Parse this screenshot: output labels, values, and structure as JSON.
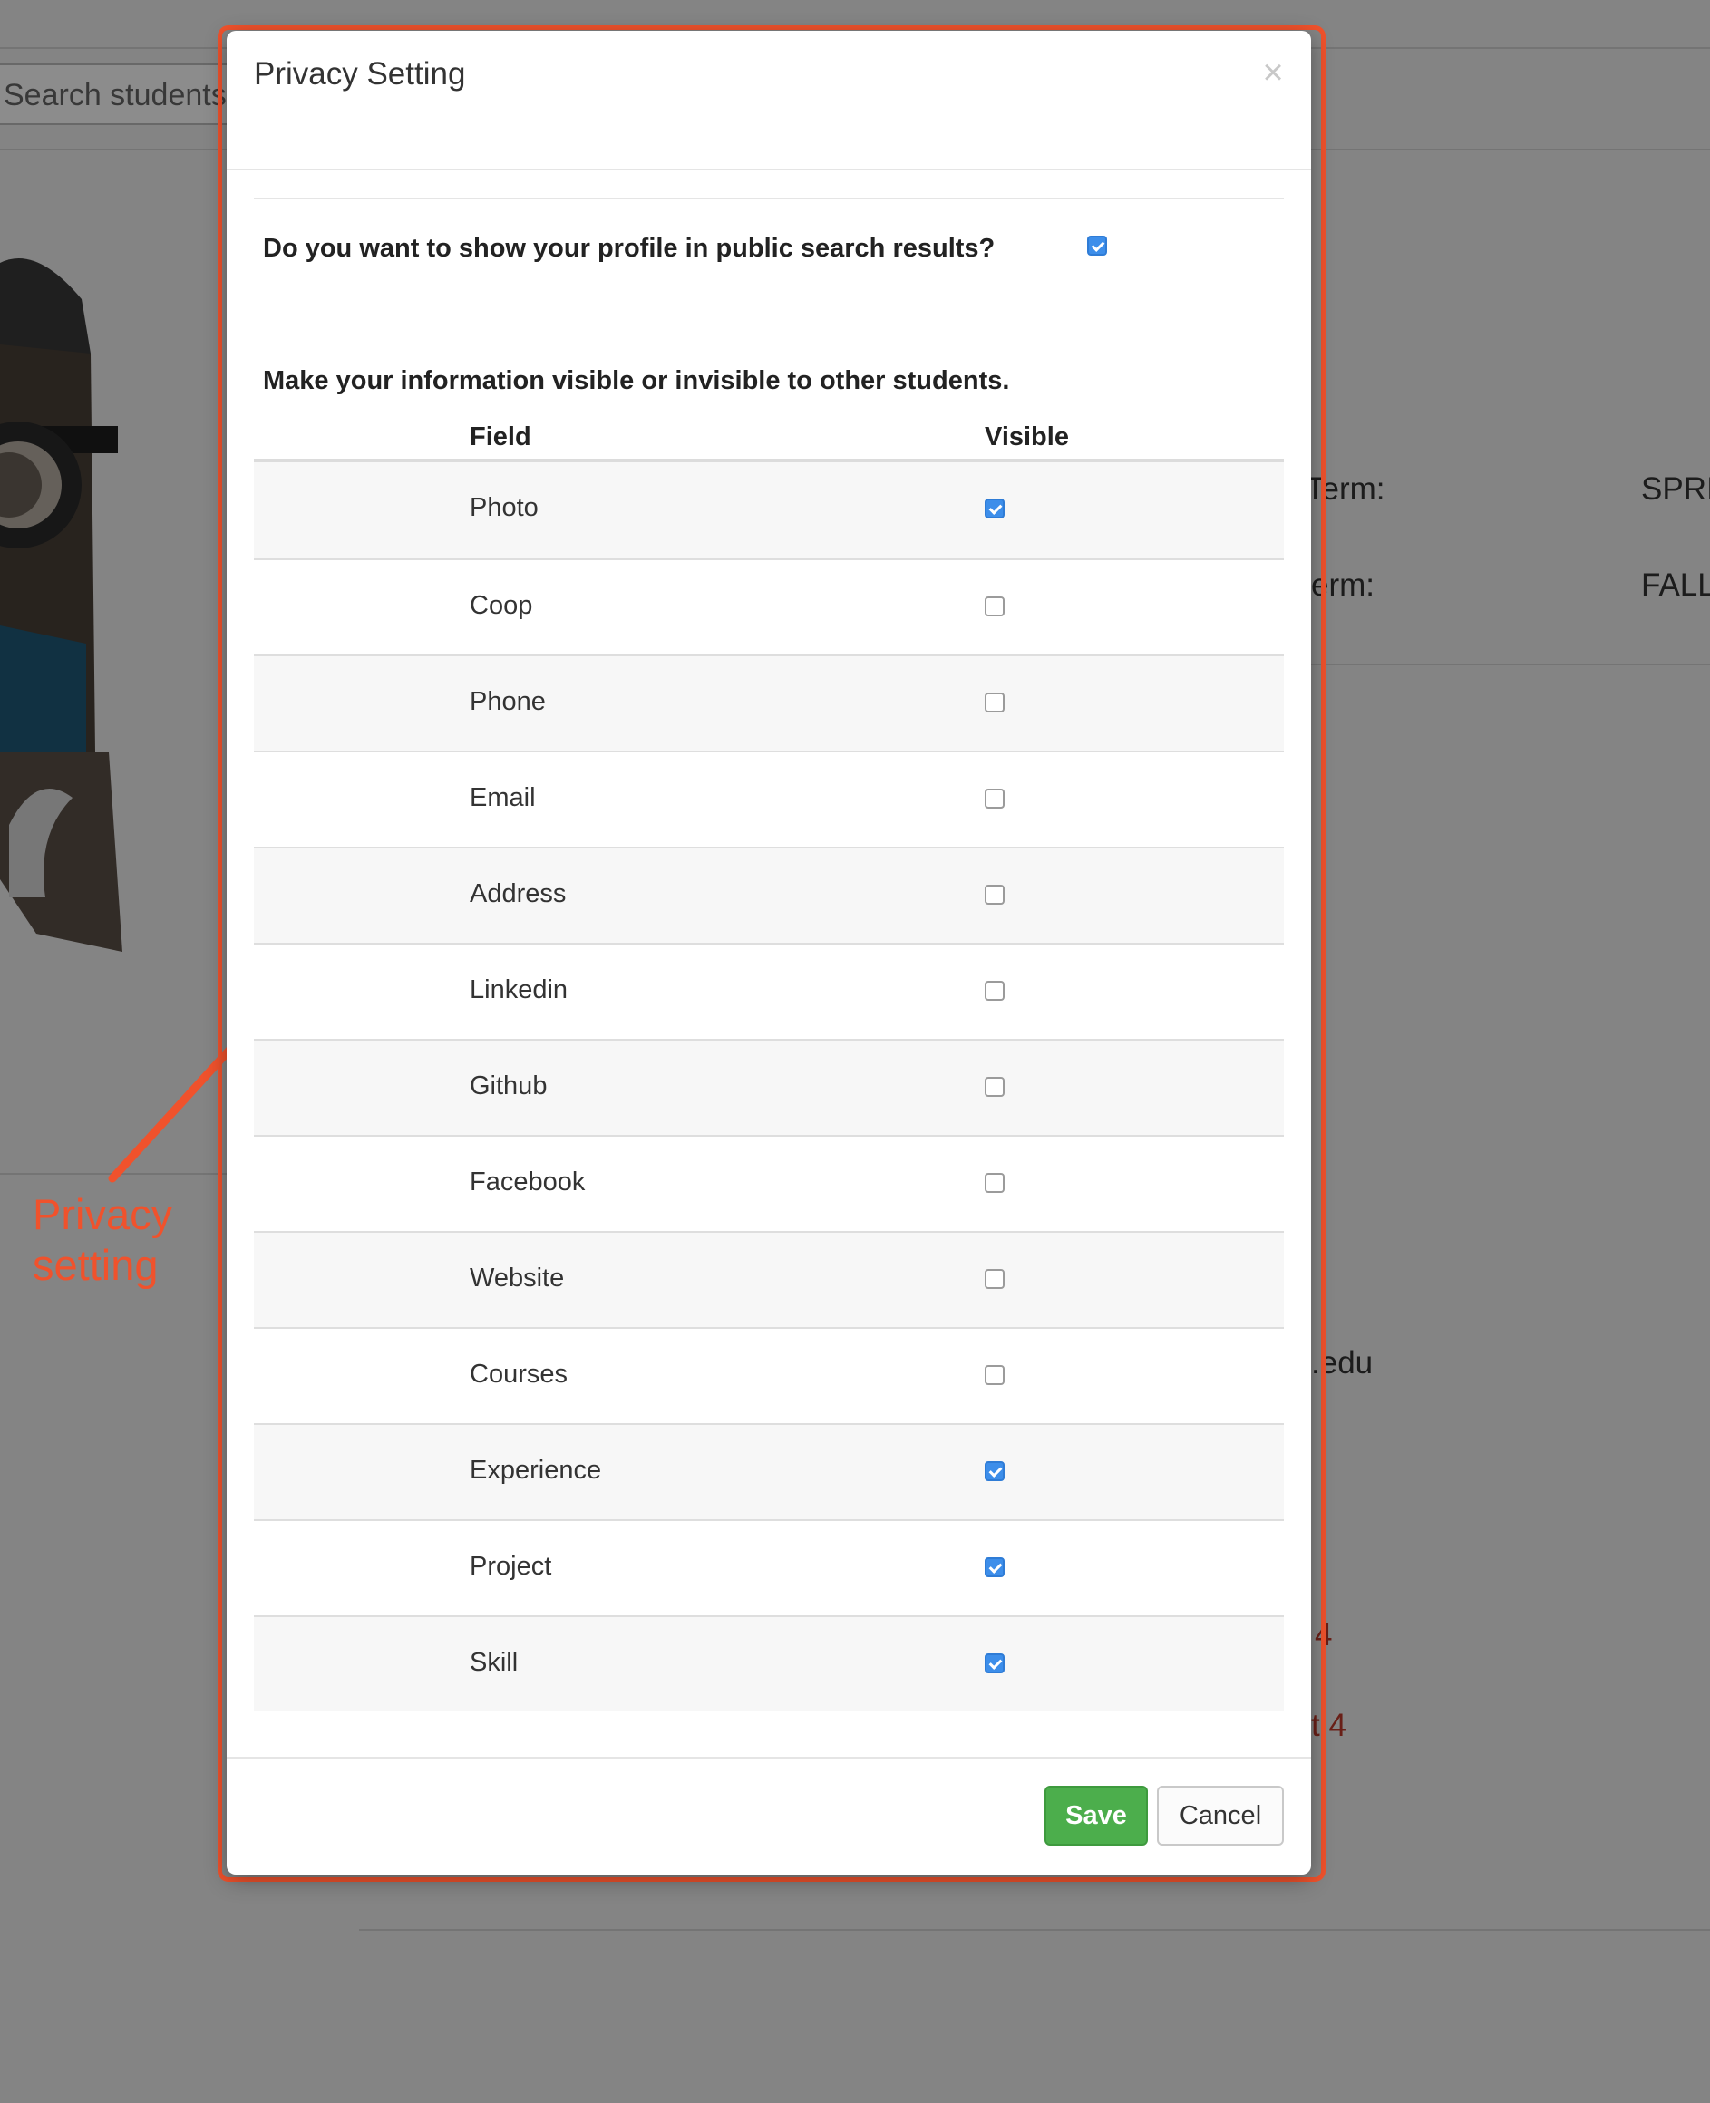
{
  "background": {
    "search_placeholder": "Search students",
    "term_label_1": "Term:",
    "term_value_1": "SPRI",
    "term_label_2": "erm:",
    "term_value_2": "FALL",
    "email_fragment": ".edu",
    "link_fragment_1": "4",
    "link_fragment_2": "t 4"
  },
  "annotation": {
    "label_line1": "Privacy",
    "label_line2": "setting",
    "color": "#f0522c"
  },
  "modal": {
    "title": "Privacy Setting",
    "close_glyph": "×",
    "public_search_question": "Do you want to show your profile in public search results?",
    "public_search_checked": true,
    "instruction": "Make your information visible or invisible to other students.",
    "columns": {
      "field": "Field",
      "visible": "Visible"
    },
    "rows": [
      {
        "field": "Photo",
        "visible": true
      },
      {
        "field": "Coop",
        "visible": false
      },
      {
        "field": "Phone",
        "visible": false
      },
      {
        "field": "Email",
        "visible": false
      },
      {
        "field": "Address",
        "visible": false
      },
      {
        "field": "Linkedin",
        "visible": false
      },
      {
        "field": "Github",
        "visible": false
      },
      {
        "field": "Facebook",
        "visible": false
      },
      {
        "field": "Website",
        "visible": false
      },
      {
        "field": "Courses",
        "visible": false
      },
      {
        "field": "Experience",
        "visible": true
      },
      {
        "field": "Project",
        "visible": true
      },
      {
        "field": "Skill",
        "visible": true
      }
    ],
    "save_label": "Save",
    "cancel_label": "Cancel"
  },
  "colors": {
    "checkbox_checked": "#3d8eea",
    "save_button": "#4cae4c",
    "overlay": "#8a8a8a"
  }
}
